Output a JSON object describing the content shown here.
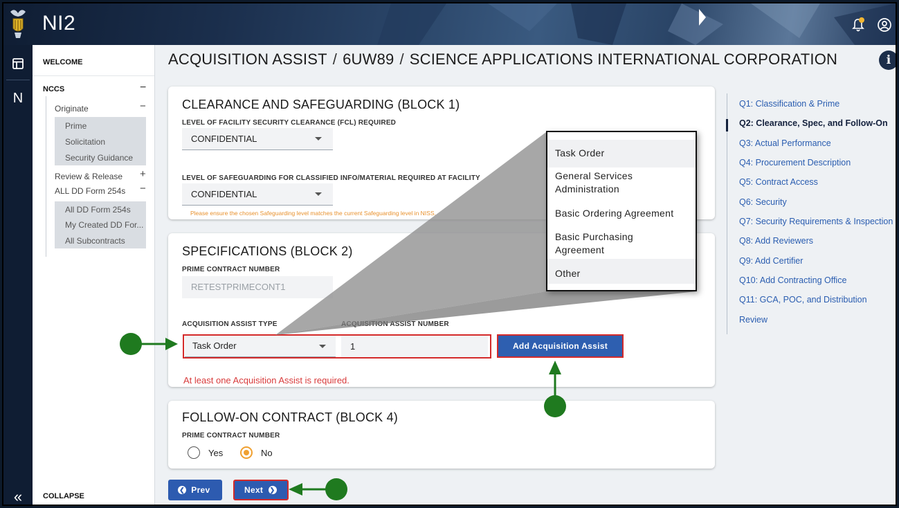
{
  "app": {
    "title": "NI2"
  },
  "rail": {
    "n_label": "N",
    "collapse_glyph": "«"
  },
  "leftnav": {
    "welcome": "WELCOME",
    "nccs": "NCCS",
    "nccs_toggle": "−",
    "originate": "Originate",
    "originate_toggle": "−",
    "originate_items": [
      "Prime",
      "Solicitation",
      "Security Guidance"
    ],
    "review_release": "Review & Release",
    "review_toggle": "+",
    "all_dd": "ALL DD Form 254s",
    "all_dd_toggle": "−",
    "all_dd_items": [
      "All DD Form 254s",
      "My Created DD For...",
      "All Subcontracts"
    ],
    "collapse": "COLLAPSE"
  },
  "breadcrumb": {
    "part1": "ACQUISITION ASSIST",
    "part2": "6UW89",
    "part3": "SCIENCE APPLICATIONS INTERNATIONAL CORPORATION",
    "sep": "/"
  },
  "info_glyph": "i",
  "block1": {
    "title": "CLEARANCE AND SAFEGUARDING (BLOCK 1)",
    "fcl_label": "LEVEL OF FACILITY SECURITY CLEARANCE (FCL) REQUIRED",
    "fcl_value": "CONFIDENTIAL",
    "safeguard_label": "LEVEL OF SAFEGUARDING FOR CLASSIFIED INFO/MATERIAL REQUIRED AT FACILITY",
    "safeguard_value": "CONFIDENTIAL",
    "warning": "Please ensure the chosen Safeguarding level matches the current Safeguarding level in NISS."
  },
  "block2": {
    "title": "SPECIFICATIONS (BLOCK 2)",
    "prime_label": "PRIME CONTRACT NUMBER",
    "prime_value": "RETESTPRIMECONT1",
    "acq_type_label": "ACQUISITION ASSIST TYPE",
    "acq_type_value": "Task Order",
    "acq_number_label": "ACQUISITION ASSIST NUMBER",
    "acq_number_value": "1",
    "add_button": "Add Acquisition Assist",
    "error": "At least one Acquisition Assist is required."
  },
  "block4": {
    "title": "FOLLOW-ON CONTRACT (BLOCK 4)",
    "prime_label": "PRIME CONTRACT NUMBER",
    "yes": "Yes",
    "no": "No",
    "selected": "No"
  },
  "buttons": {
    "prev": "Prev",
    "next": "Next"
  },
  "toc": {
    "items": [
      "Q1: Classification & Prime",
      "Q2: Clearance, Spec, and Follow-On",
      "Q3: Actual Performance",
      "Q4: Procurement Description",
      "Q5: Contract Access",
      "Q6: Security",
      "Q7: Security Requirements & Inspection",
      "Q8: Add Reviewers",
      "Q9: Add Certifier",
      "Q10: Add Contracting Office",
      "Q11: GCA, POC, and Distribution",
      "Review"
    ],
    "active_index": 1
  },
  "dropdown": {
    "options": [
      "Task Order",
      "General Services Administration",
      "Basic Ordering Agreement",
      "Basic Purchasing Agreement",
      "Other"
    ],
    "highlighted": "Task Order"
  },
  "colors": {
    "accent_blue": "#2d5bb0",
    "error_red": "#d83b3b",
    "annotation_green": "#1f7a1f",
    "warning_orange": "#e8912d"
  }
}
